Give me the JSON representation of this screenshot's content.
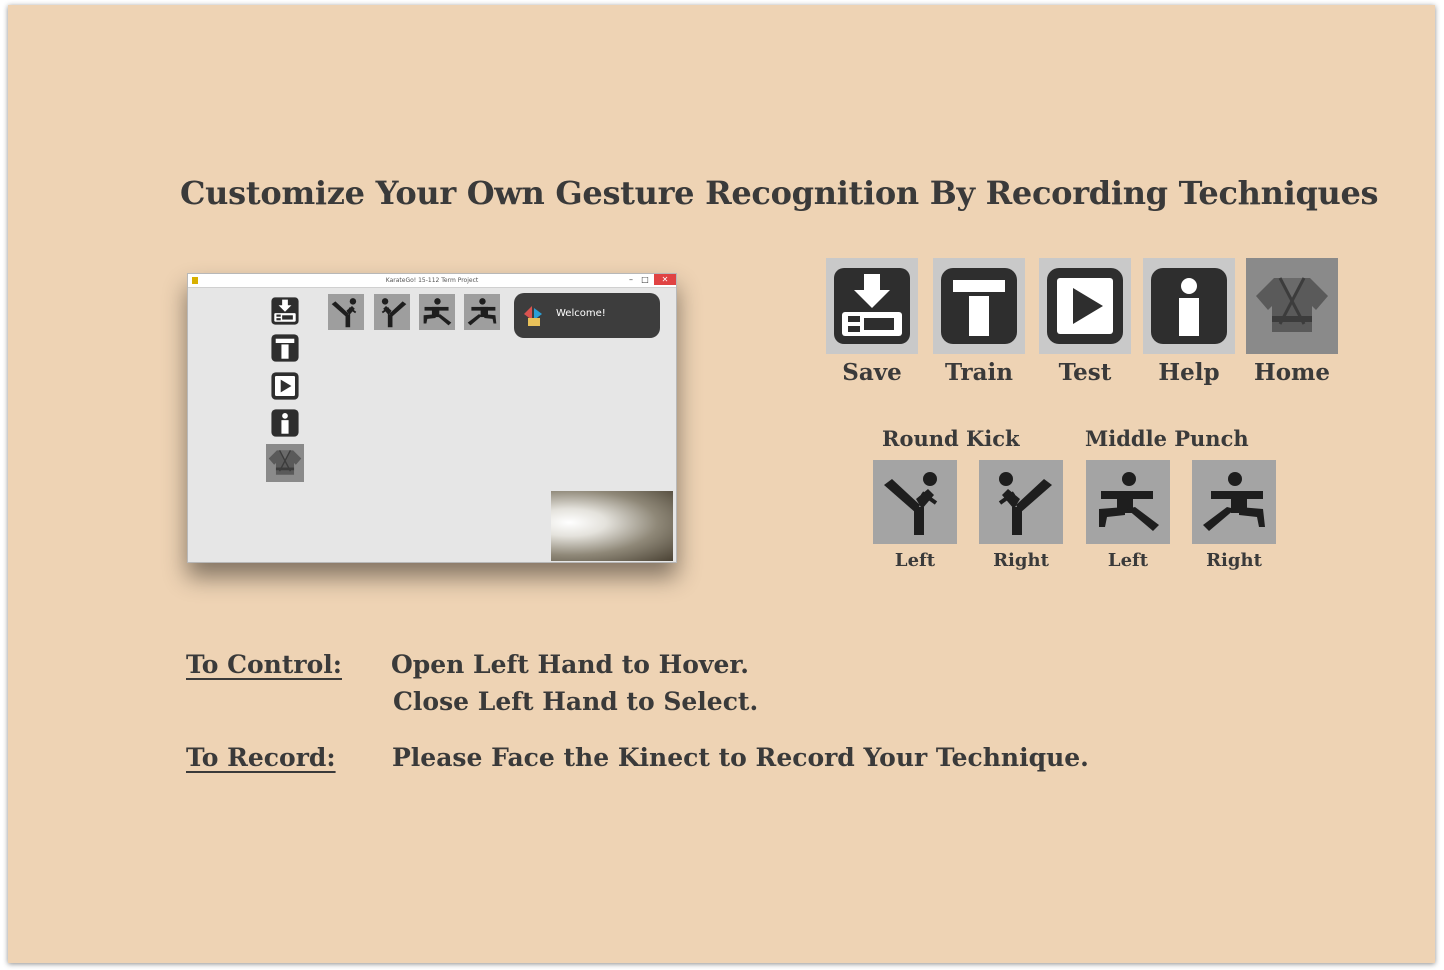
{
  "title": "Customize Your Own Gesture Recognition By Recording Techniques",
  "screenshot": {
    "window_title": "KarateGo! 15-112 Term Project",
    "welcome_text": "Welcome!",
    "close_glyph": "✕",
    "minimize_glyph": "–",
    "maximize_glyph": "□",
    "sidebar_icons": [
      "save-icon",
      "train-icon",
      "test-icon",
      "help-icon",
      "home-icon"
    ],
    "technique_icons": [
      "round-kick-left-icon",
      "round-kick-right-icon",
      "middle-punch-left-icon",
      "middle-punch-right-icon"
    ]
  },
  "toolbar": {
    "items": [
      {
        "label": "Save",
        "icon": "save-icon"
      },
      {
        "label": "Train",
        "icon": "train-icon"
      },
      {
        "label": "Test",
        "icon": "test-icon"
      },
      {
        "label": "Help",
        "icon": "help-icon"
      },
      {
        "label": "Home",
        "icon": "home-icon"
      }
    ]
  },
  "techniques": {
    "groups": [
      {
        "title": "Round Kick",
        "items": [
          {
            "label": "Left",
            "icon": "round-kick-left-icon"
          },
          {
            "label": "Right",
            "icon": "round-kick-right-icon"
          }
        ]
      },
      {
        "title": "Middle Punch",
        "items": [
          {
            "label": "Left",
            "icon": "middle-punch-left-icon"
          },
          {
            "label": "Right",
            "icon": "middle-punch-right-icon"
          }
        ]
      }
    ]
  },
  "instructions": {
    "control_label": "To Control:",
    "control_lines": [
      "Open Left Hand to Hover.",
      "Close Left Hand to Select."
    ],
    "record_label": "To Record:",
    "record_line": "Please Face the Kinect to Record Your Technique."
  },
  "colors": {
    "background": "#eed3b4",
    "text": "#3a3a3a",
    "icon_dark": "#2e2e2e"
  }
}
